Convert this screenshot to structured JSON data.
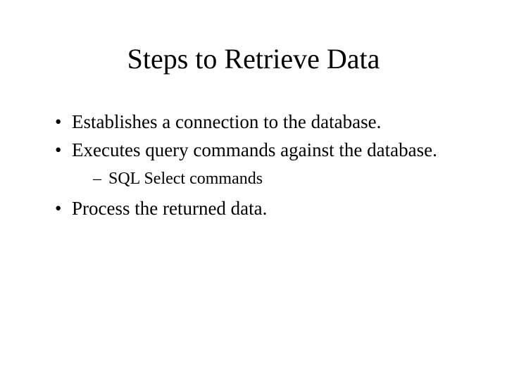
{
  "slide": {
    "title": "Steps to Retrieve Data",
    "bullets": [
      {
        "text": "Establishes a connection to the database.",
        "sub": []
      },
      {
        "text": "Executes query commands against the database.",
        "sub": [
          {
            "text": "SQL Select commands"
          }
        ]
      },
      {
        "text": "Process the returned data.",
        "sub": []
      }
    ]
  }
}
